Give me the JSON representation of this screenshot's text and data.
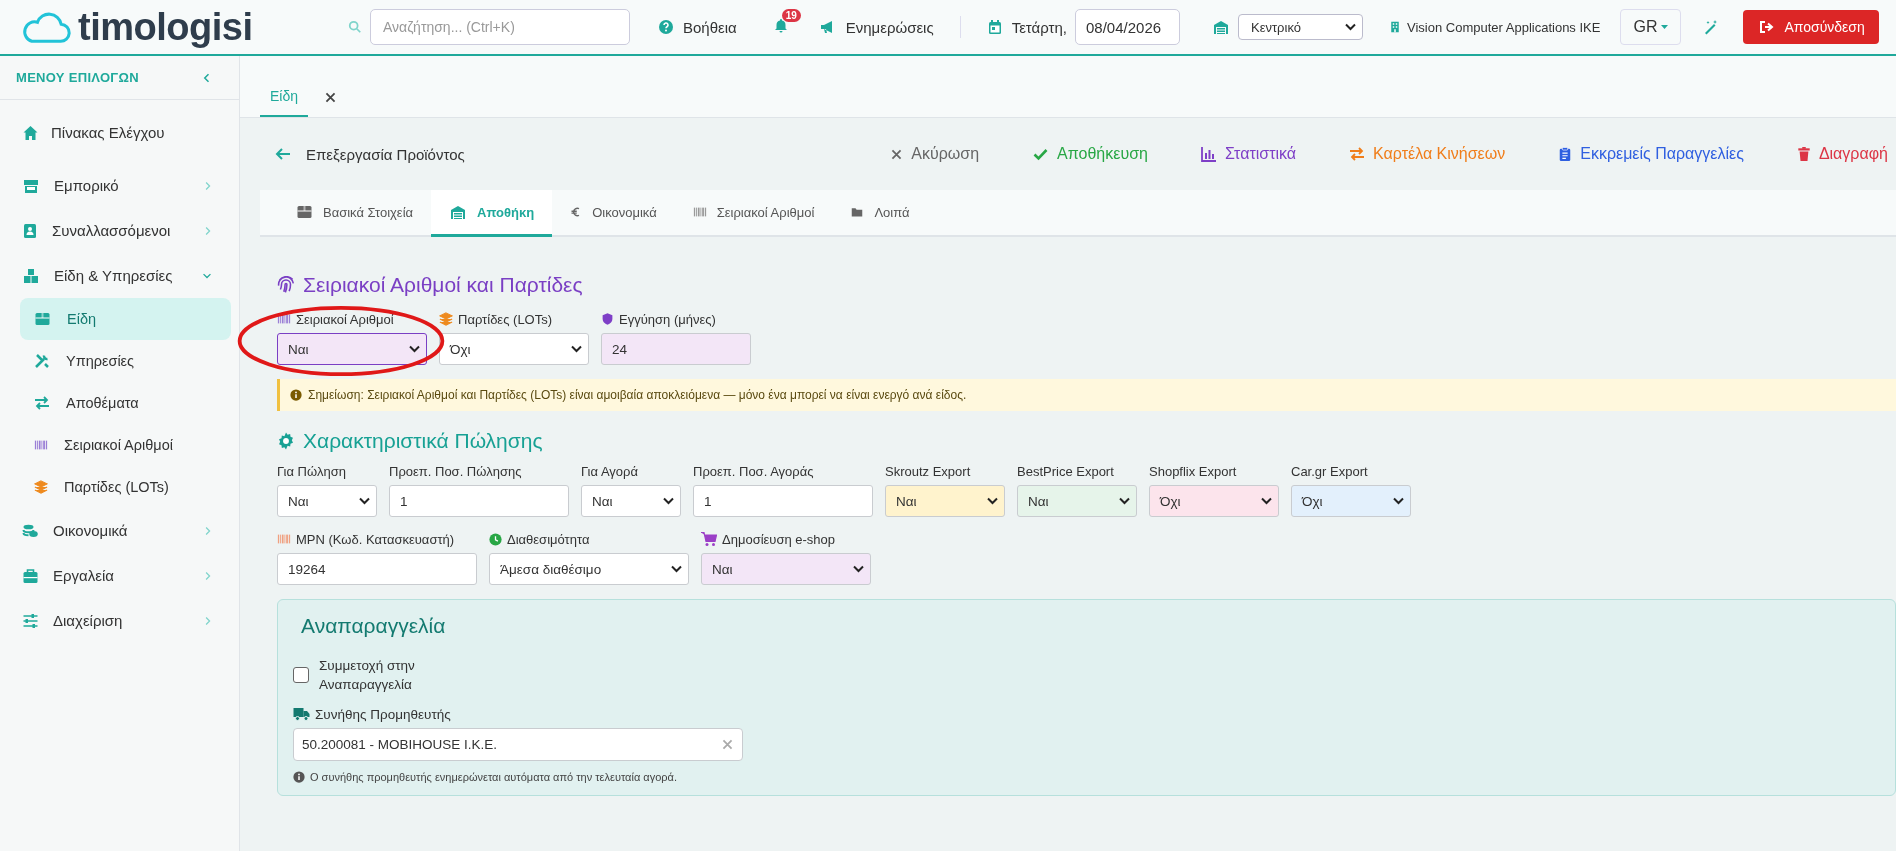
{
  "header": {
    "logo": "timologisi",
    "search_placeholder": "Αναζήτηση... (Ctrl+K)",
    "help": "Βοήθεια",
    "notifications_badge": "19",
    "updates": "Ενημερώσεις",
    "day": "Τετάρτη,",
    "date": "08/04/2026",
    "branch": "Κεντρικό",
    "company": "Vision Computer Applications IKE",
    "language": "GR",
    "logout": "Αποσύνδεση"
  },
  "sidebar": {
    "title": "ΜΕΝΟΥ ΕΠΙΛΟΓΩΝ",
    "items": [
      {
        "label": "Πίνακας Ελέγχου",
        "has_children": false
      },
      {
        "label": "Εμπορικό",
        "expanded": false,
        "has_children": true
      },
      {
        "label": "Συναλλασσόμενοι",
        "expanded": false,
        "has_children": true
      },
      {
        "label": "Είδη & Υπηρεσίες",
        "expanded": true,
        "has_children": true,
        "children": [
          {
            "label": "Είδη",
            "selected": true
          },
          {
            "label": "Υπηρεσίες",
            "selected": false
          },
          {
            "label": "Αποθέματα",
            "selected": false
          },
          {
            "label": "Σειριακοί Αριθμοί",
            "selected": false
          },
          {
            "label": "Παρτίδες (LOTs)",
            "selected": false
          }
        ]
      },
      {
        "label": "Οικονομικά",
        "expanded": false,
        "has_children": true
      },
      {
        "label": "Εργαλεία",
        "expanded": false,
        "has_children": true
      },
      {
        "label": "Διαχείριση",
        "expanded": false,
        "has_children": true
      }
    ]
  },
  "doc_tabs": [
    {
      "label": "Είδη",
      "selected": true
    }
  ],
  "page": {
    "title": "Επεξεργασία Προϊόντος",
    "actions": [
      {
        "kind": "cancel",
        "label": "Ακύρωση"
      },
      {
        "kind": "save",
        "label": "Αποθήκευση"
      },
      {
        "kind": "stats",
        "label": "Στατιστικά"
      },
      {
        "kind": "movements",
        "label": "Καρτέλα Κινήσεων"
      },
      {
        "kind": "orders",
        "label": "Εκκρεμείς Παραγγελίες"
      },
      {
        "kind": "delete",
        "label": "Διαγραφή"
      }
    ]
  },
  "tabs": [
    {
      "label": "Βασικά Στοιχεία",
      "selected": false
    },
    {
      "label": "Αποθήκη",
      "selected": true
    },
    {
      "label": "Οικονομικά",
      "selected": false
    },
    {
      "label": "Σειριακοί Αριθμοί",
      "selected": false
    },
    {
      "label": "Λοιπά",
      "selected": false
    }
  ],
  "serials": {
    "title": "Σειριακοί Αριθμοί και Παρτίδες",
    "fields": [
      {
        "kind": "select",
        "label": "Σειριακοί Αριθμοί",
        "value": "Ναι",
        "color": "#f3e6f7",
        "highlighted": true
      },
      {
        "kind": "select",
        "label": "Παρτίδες (LOTs)",
        "value": "Όχι",
        "color": "#ffffff",
        "highlighted": false
      },
      {
        "kind": "input",
        "label": "Εγγύηση (μήνες)",
        "value": "24",
        "color": "#f3e6f7",
        "highlighted": false
      }
    ],
    "note": "Σημείωση: Σειριακοί Αριθμοί και Παρτίδες (LOTs) είναι αμοιβαία αποκλειόμενα — μόνο ένα μπορεί να είναι ενεργό ανά είδος."
  },
  "sales": {
    "title": "Χαρακτηριστικά Πώλησης",
    "fields": [
      {
        "kind": "select",
        "label": "Για Πώληση",
        "value": "Ναι",
        "color": "#ffffff"
      },
      {
        "kind": "input",
        "label": "Προεπ. Ποσ. Πώλησης",
        "value": "1",
        "color": "#ffffff"
      },
      {
        "kind": "select",
        "label": "Για Αγορά",
        "value": "Ναι",
        "color": "#ffffff"
      },
      {
        "kind": "input",
        "label": "Προεπ. Ποσ. Αγοράς",
        "value": "1",
        "color": "#ffffff"
      },
      {
        "kind": "select",
        "label": "Skroutz Export",
        "value": "Ναι",
        "color": "#fff3cd"
      },
      {
        "kind": "select",
        "label": "BestPrice Export",
        "value": "Ναι",
        "color": "#e6f4ea"
      },
      {
        "kind": "select",
        "label": "Shopflix Export",
        "value": "Όχι",
        "color": "#fce4ec"
      },
      {
        "kind": "select",
        "label": "Car.gr Export",
        "value": "Όχι",
        "color": "#e3f0fc"
      }
    ],
    "details": [
      {
        "kind": "input",
        "label": "MPN (Κωδ. Κατασκευαστή)",
        "value": "19264",
        "color": "#ffffff"
      },
      {
        "kind": "select",
        "label": "Διαθεσιμότητα",
        "value": "Άμεσα διαθέσιμο",
        "color": "#ffffff"
      },
      {
        "kind": "select",
        "label": "Δημοσίευση e-shop",
        "value": "Ναι",
        "color": "#f3e6f7"
      }
    ]
  },
  "reorder": {
    "title": "Αναπαραγγελία",
    "participate_label": "Συμμετοχή στην Αναπαραγγελία",
    "checked": false,
    "supplier_label": "Συνήθης Προμηθευτής",
    "supplier_value": "50.200081 - MOBIHOUSE I.K.E.",
    "hint": "Ο συνήθης προμηθευτής ενημερώνεται αυτόματα από την τελευταία αγορά."
  }
}
